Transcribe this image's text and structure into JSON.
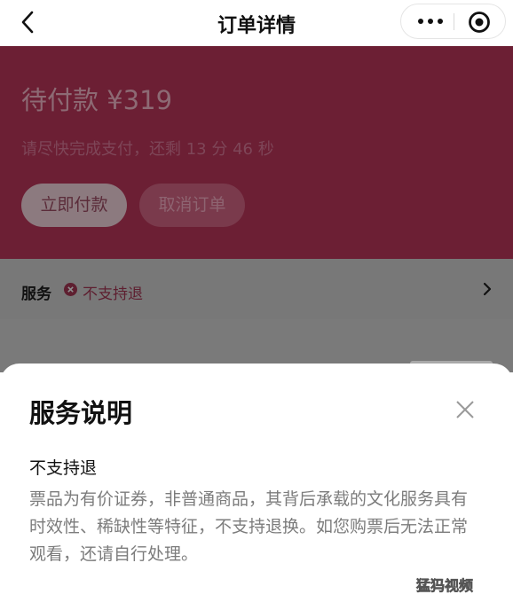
{
  "navbar": {
    "title": "订单详情",
    "back_icon": "chevron-left-icon",
    "more_icon": "more-dots-icon",
    "close_icon": "target-circle-icon"
  },
  "order_status": {
    "title": "待付款 ¥319",
    "countdown": "请尽快完成支付，还剩 13 分 46 秒",
    "pay_button": "立即付款",
    "cancel_button": "取消订单"
  },
  "service": {
    "label": "服务",
    "status_icon": "x-circle-icon",
    "status": "不支持退",
    "chevron_icon": "chevron-right-icon"
  },
  "sheet": {
    "title": "服务说明",
    "close_icon": "close-icon",
    "policy_heading": "不支持退",
    "policy_text": "票品为有价证券，非普通商品，其背后承载的文化服务具有时效性、稀缺性等特征，不支持退换。如您购票后无法正常观看，还请自行处理。"
  },
  "watermark": "猛犸视频",
  "colors": {
    "status_bg": "#6c1f34",
    "overlay_gray": "#787878",
    "accent_red": "#5e1f30"
  }
}
